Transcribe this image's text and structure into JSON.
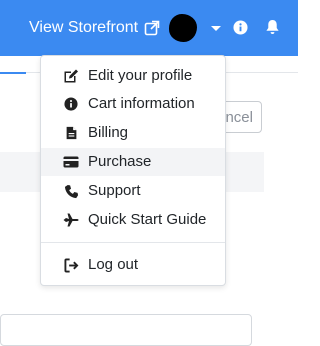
{
  "header": {
    "storefront_label": "View Storefront",
    "icons": [
      "external-link-icon",
      "avatar",
      "caret-down-icon",
      "info-circle-icon",
      "bell-icon"
    ],
    "bar_color": "#3b8af1"
  },
  "background": {
    "cancel_label": "ncel"
  },
  "menu": {
    "items": [
      {
        "label": "Edit your profile",
        "icon": "edit-icon"
      },
      {
        "label": "Cart information",
        "icon": "info-circle-icon"
      },
      {
        "label": "Billing",
        "icon": "file-invoice-icon"
      },
      {
        "label": "Purchase",
        "icon": "credit-card-icon"
      },
      {
        "label": "Support",
        "icon": "phone-icon"
      },
      {
        "label": "Quick Start Guide",
        "icon": "plane-icon"
      }
    ],
    "logout": {
      "label": "Log out",
      "icon": "sign-out-icon"
    },
    "highlighted_item": "Purchase"
  }
}
